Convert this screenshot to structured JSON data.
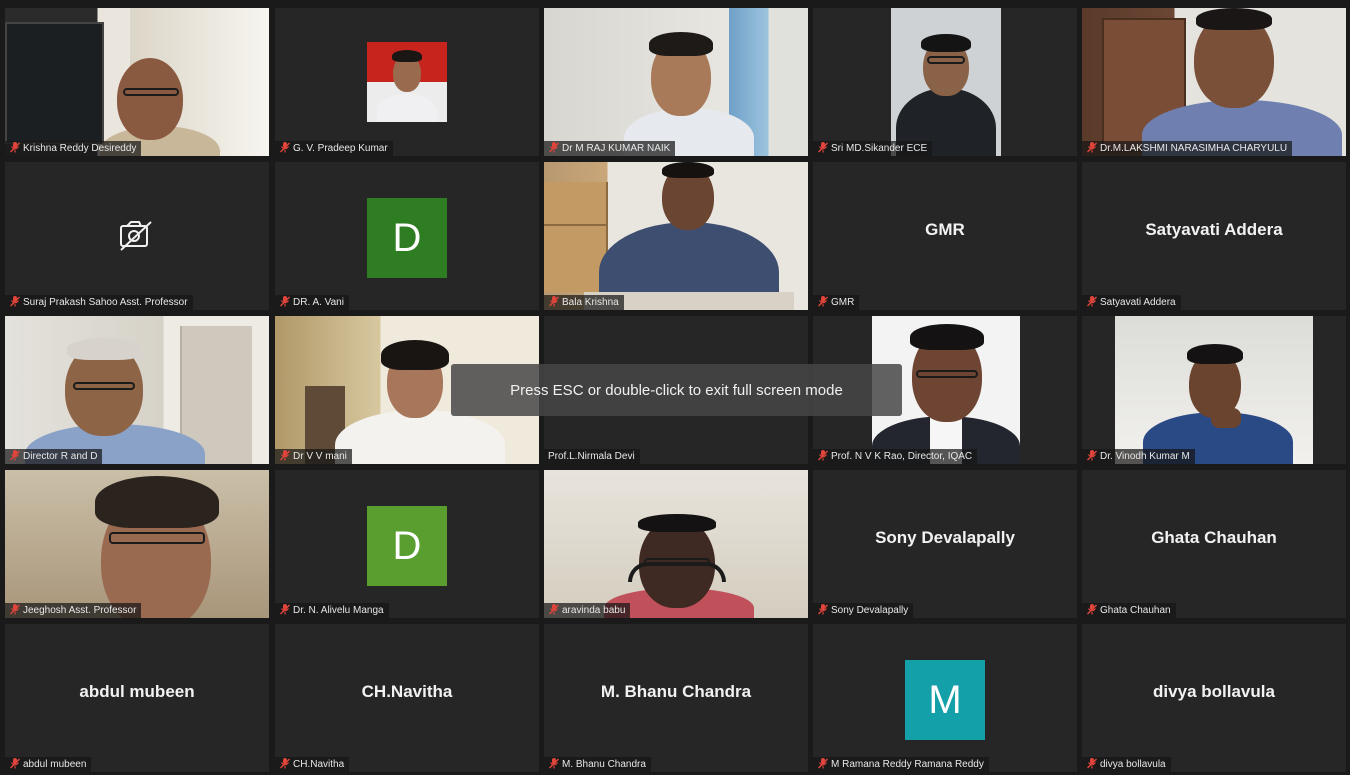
{
  "toast": {
    "text": "Press ESC or double-click to exit full screen mode"
  },
  "participants": [
    {
      "name": "Krishna Reddy Desireddy",
      "mode": "video"
    },
    {
      "name": "G. V. Pradeep Kumar",
      "mode": "photo"
    },
    {
      "name": "Dr M RAJ KUMAR NAIK",
      "mode": "video"
    },
    {
      "name": "Sri MD.Sikander ECE",
      "mode": "video"
    },
    {
      "name": "Dr.M.LAKSHMI NARASIMHA CHARYULU",
      "mode": "video",
      "active_speaker": true
    },
    {
      "name": "Suraj Prakash Sahoo Asst. Professor",
      "mode": "camera-off"
    },
    {
      "name": "DR. A. Vani",
      "mode": "avatar",
      "initial": "D",
      "color": "#2e7d22"
    },
    {
      "name": "Bala Krishna",
      "mode": "video"
    },
    {
      "name": "GMR",
      "mode": "name",
      "big": "GMR"
    },
    {
      "name": "Satyavati Addera",
      "mode": "name",
      "big": "Satyavati Addera"
    },
    {
      "name": "Director R and D",
      "mode": "video"
    },
    {
      "name": "Dr V V mani",
      "mode": "video"
    },
    {
      "name": "Prof.L.Nirmala Devi",
      "mode": "blank"
    },
    {
      "name": "Prof. N V K Rao, Director, IQAC",
      "mode": "video"
    },
    {
      "name": "Dr. Vinodh Kumar M",
      "mode": "video"
    },
    {
      "name": "Jeeghosh Asst. Professor",
      "mode": "video"
    },
    {
      "name": "Dr. N. Alivelu Manga",
      "mode": "avatar",
      "initial": "D",
      "color": "#5a9e2f"
    },
    {
      "name": "aravinda babu",
      "mode": "video"
    },
    {
      "name": "Sony Devalapally",
      "mode": "name",
      "big": "Sony Devalapally"
    },
    {
      "name": "Ghata Chauhan",
      "mode": "name",
      "big": "Ghata Chauhan"
    },
    {
      "name": "abdul mubeen",
      "mode": "name",
      "big": "abdul mubeen"
    },
    {
      "name": "CH.Navitha",
      "mode": "name",
      "big": "CH.Navitha"
    },
    {
      "name": "M. Bhanu Chandra",
      "mode": "name",
      "big": "M. Bhanu Chandra"
    },
    {
      "name": "M Ramana Reddy Ramana Reddy",
      "mode": "avatar",
      "initial": "M",
      "color": "#14a0a8"
    },
    {
      "name": "divya bollavula",
      "mode": "name",
      "big": "divya bollavula"
    }
  ],
  "icons": {
    "mic": "mic-muted-icon",
    "camera": "camera-off-icon"
  },
  "colors": {
    "active_border": "#c8dc3c",
    "muted": "#e0443a",
    "tile": "#262626"
  }
}
